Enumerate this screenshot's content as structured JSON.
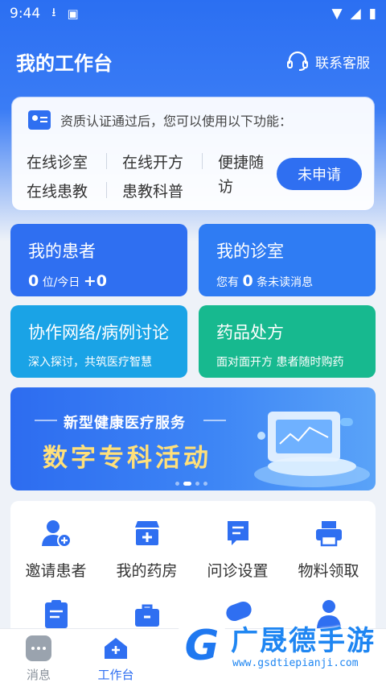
{
  "status": {
    "time": "9:44"
  },
  "header": {
    "title": "我的工作台",
    "service_label": "联系客服"
  },
  "notice": {
    "text": "资质认证通过后，您可以使用以下功能：",
    "features": [
      "在线诊室",
      "在线开方",
      "便捷随",
      "访",
      "在线患教",
      "患教科普"
    ],
    "button": "未申请"
  },
  "cards": {
    "patients": {
      "title": "我的患者",
      "count": "0",
      "count_unit": "位/今日",
      "today": "+0",
      "color": "#2f6ff1"
    },
    "clinic": {
      "title": "我的诊室",
      "prefix": "您有",
      "count": "0",
      "suffix": "条未读消息",
      "color": "#2f7cf3"
    },
    "network": {
      "title": "协作网络/病例讨论",
      "sub": "深入探讨，共筑医疗智慧",
      "color": "#1aa3e6"
    },
    "rx": {
      "title": "药品处方",
      "sub": "面对面开方 患者随时购药",
      "color": "#17b98f"
    }
  },
  "banner": {
    "subtitle": "新型健康医疗服务",
    "title": "数字专科活动",
    "slide_index": 1,
    "slide_count": 4
  },
  "tools": [
    {
      "label": "邀请患者",
      "icon": "add-user-icon"
    },
    {
      "label": "我的药房",
      "icon": "pharmacy-icon"
    },
    {
      "label": "问诊设置",
      "icon": "settings-doc-icon"
    },
    {
      "label": "物料领取",
      "icon": "printer-icon"
    }
  ],
  "tabbar": {
    "messages": "消息",
    "workbench": "工作台",
    "active": "workbench"
  },
  "watermark": {
    "name": "广晟德手游",
    "url": "www.gsdtiepianji.com"
  },
  "colors": {
    "primary": "#2f6ff1",
    "accent_yellow": "#ffe07a"
  }
}
